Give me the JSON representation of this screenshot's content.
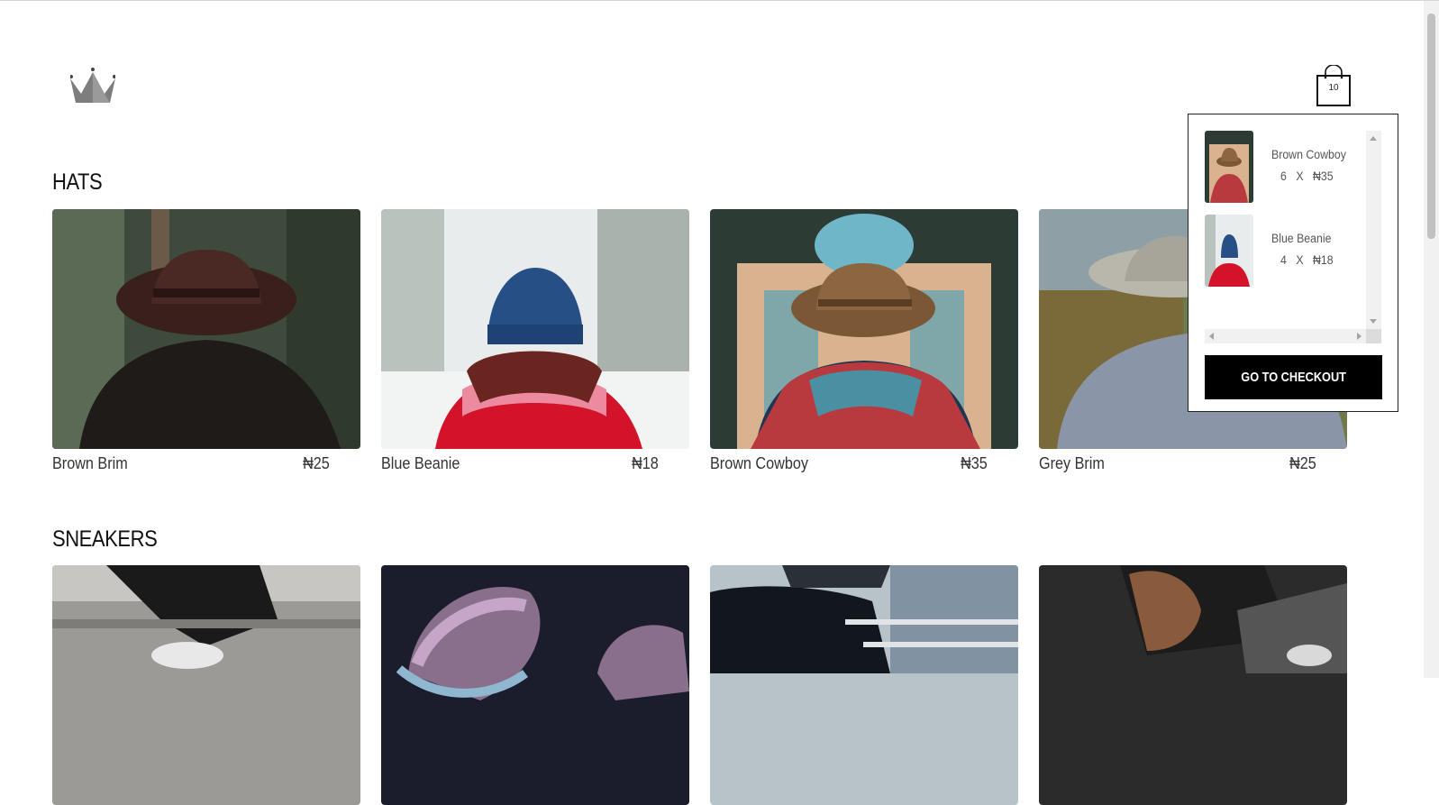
{
  "header": {
    "logo_icon": "crown-icon",
    "cart_icon": "shopping-bag-icon",
    "cart_count": "10"
  },
  "sections": [
    {
      "title": "HATS",
      "products": [
        {
          "name": "Brown Brim",
          "price": "₦25"
        },
        {
          "name": "Blue Beanie",
          "price": "₦18"
        },
        {
          "name": "Brown Cowboy",
          "price": "₦35"
        },
        {
          "name": "Grey Brim",
          "price": "₦25"
        }
      ]
    },
    {
      "title": "SNEAKERS",
      "products": []
    }
  ],
  "cart_dropdown": {
    "items": [
      {
        "name": "Brown Cowboy",
        "quantity": "6",
        "times": "X",
        "price": "₦35"
      },
      {
        "name": "Blue Beanie",
        "quantity": "4",
        "times": "X",
        "price": "₦18"
      }
    ],
    "checkout_label": "GO TO CHECKOUT"
  }
}
